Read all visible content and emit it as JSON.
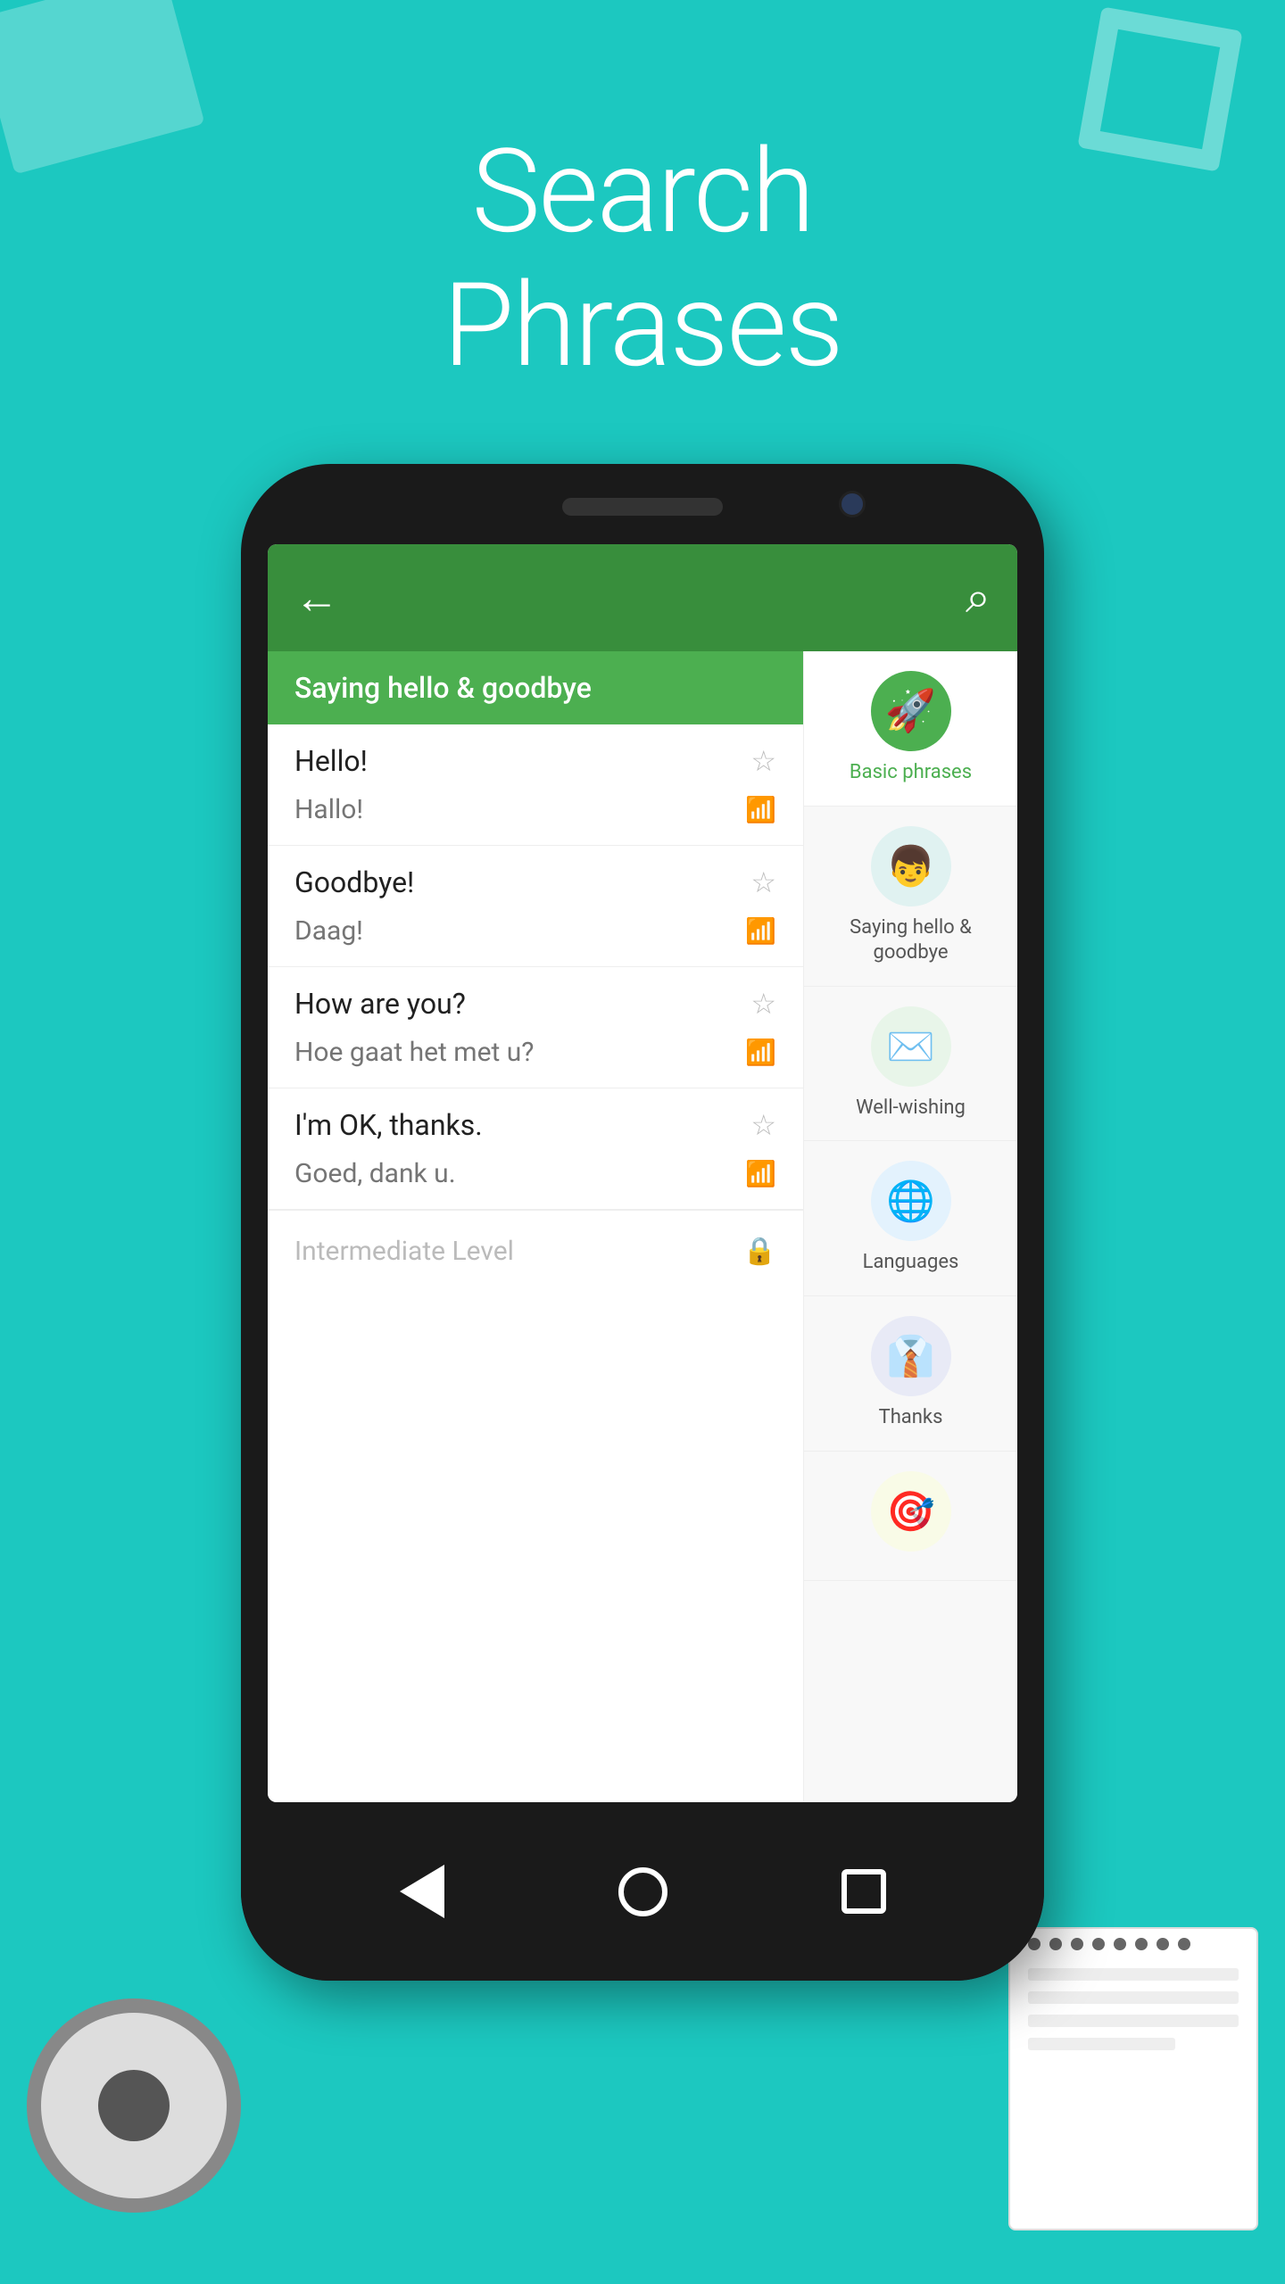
{
  "hero": {
    "title_line1": "Search",
    "title_line2": "Phrases",
    "background_color": "#1CC8C0"
  },
  "app": {
    "back_icon": "←",
    "search_icon": "⌕",
    "category_header": "Saying hello & goodbye",
    "phrases": [
      {
        "english": "Hello!",
        "translation": "Hallo!",
        "has_star": true,
        "has_audio": true
      },
      {
        "english": "Goodbye!",
        "translation": "Daag!",
        "has_star": true,
        "has_audio": true
      },
      {
        "english": "How are you?",
        "translation": "Hoe gaat het met u?",
        "has_star": true,
        "has_audio": true
      },
      {
        "english": "I'm OK, thanks.",
        "translation": "Goed, dank u.",
        "has_star": true,
        "has_audio": true
      }
    ],
    "locked_item": "Intermediate Level",
    "categories": [
      {
        "label": "Basic phrases",
        "icon": "🚀",
        "bg_class": "cat-icon-green",
        "active": true
      },
      {
        "label": "Saying hello & goodbye",
        "icon": "👦",
        "bg_class": "cat-icon-teal",
        "active": false
      },
      {
        "label": "Well-wishing",
        "icon": "✉",
        "bg_class": "cat-icon-gray",
        "active": false
      },
      {
        "label": "Languages",
        "icon": "🌐",
        "bg_class": "cat-icon-blue",
        "active": false
      },
      {
        "label": "Thanks",
        "icon": "👔",
        "bg_class": "cat-icon-orange",
        "active": false
      }
    ]
  }
}
